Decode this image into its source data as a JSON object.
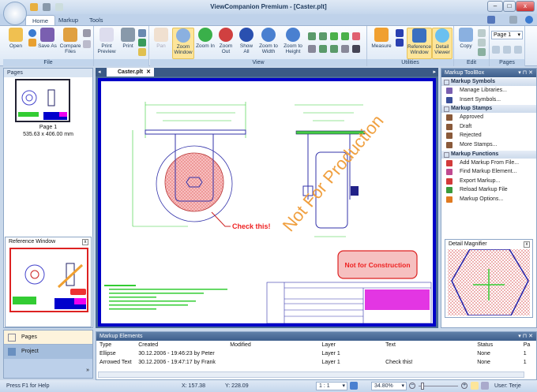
{
  "window": {
    "title": "ViewCompanion Premium - [Caster.plt]",
    "minimize": "–",
    "maximize": "□",
    "close": "x"
  },
  "ribbon": {
    "tabs": [
      {
        "label": "Home",
        "active": true
      },
      {
        "label": "Markup"
      },
      {
        "label": "Tools"
      }
    ],
    "groups": {
      "file": "File",
      "view": "View",
      "utilities": "Utilities",
      "edit": "Edit",
      "pages": "Pages"
    },
    "buttons": {
      "open": "Open",
      "save_as": "Save As",
      "compare_files": "Compare Files",
      "print_preview": "Print Preview",
      "print": "Print",
      "pan": "Pan",
      "zoom_window": "Zoom Window",
      "zoom_in": "Zoom In",
      "zoom_out": "Zoom Out",
      "show_all": "Show All",
      "zoom_to_width": "Zoom to Width",
      "zoom_to_height": "Zoom to Height",
      "measure": "Measure",
      "reference_window": "Reference Window",
      "detail_viewer": "Detail Viewer",
      "copy": "Copy"
    },
    "page_select": "Page 1"
  },
  "pages_panel": {
    "title": "Pages",
    "page_label": "Page 1",
    "page_size": "535.63 x 406.00 mm"
  },
  "reference_window": {
    "title": "Reference Window"
  },
  "nav": {
    "pages": "Pages",
    "project": "Project"
  },
  "document": {
    "tab": "Caster.plt",
    "annotations": {
      "check": "Check this!",
      "watermark": "Not For Production",
      "stamp": "Not for Construction"
    }
  },
  "toolbox": {
    "title": "Markup ToolBox",
    "sections": [
      {
        "title": "Markup Symbols",
        "items": [
          {
            "label": "Manage Libraries...",
            "icon": "library-icon",
            "color": "#7a5fb0"
          },
          {
            "label": "Insert Symbols...",
            "icon": "symbol-icon",
            "color": "#3a4f9a"
          }
        ]
      },
      {
        "title": "Markup Stamps",
        "items": [
          {
            "label": "Approved",
            "icon": "stamp-icon",
            "color": "#8a5a3a"
          },
          {
            "label": "Draft",
            "icon": "stamp-icon",
            "color": "#8a5a3a"
          },
          {
            "label": "Rejected",
            "icon": "stamp-icon",
            "color": "#8a5a3a"
          },
          {
            "label": "More Stamps...",
            "icon": "stamp-icon",
            "color": "#8a5a3a"
          }
        ]
      },
      {
        "title": "Markup Functions",
        "items": [
          {
            "label": "Add Markup From File...",
            "icon": "add-markup-icon",
            "color": "#d23a3a"
          },
          {
            "label": "Find Markup Element...",
            "icon": "find-icon",
            "color": "#c04a90"
          },
          {
            "label": "Export Markup...",
            "icon": "export-icon",
            "color": "#d23a3a"
          },
          {
            "label": "Reload Markup File",
            "icon": "reload-icon",
            "color": "#3a9a3a"
          },
          {
            "label": "Markup Options...",
            "icon": "options-icon",
            "color": "#e07a20"
          }
        ]
      }
    ]
  },
  "magnifier": {
    "title": "Detail Magnifier"
  },
  "markup_elements": {
    "title": "Markup Elements",
    "columns": [
      "Type",
      "Created",
      "Modified",
      "Layer",
      "Text",
      "Status",
      "Pa"
    ],
    "rows": [
      [
        "Ellipse",
        "30.12.2006 - 19:46:23 by Peter",
        "",
        "Layer 1",
        "",
        "None",
        "1"
      ],
      [
        "Arrowed Text",
        "30.12.2006 - 19:47:17 by Frank",
        "",
        "Layer 1",
        "Check this!",
        "None",
        "1"
      ]
    ]
  },
  "status": {
    "help": "Press F1 for Help",
    "x": "X: 157.38",
    "y": "Y: 228.09",
    "scale": "1 : 1",
    "zoom": "34.80%",
    "user": "User: Terje"
  },
  "colors": {
    "accent": "#fde59a",
    "drawing_border": "#0000c8",
    "panel_header": "#3e5f8c"
  }
}
